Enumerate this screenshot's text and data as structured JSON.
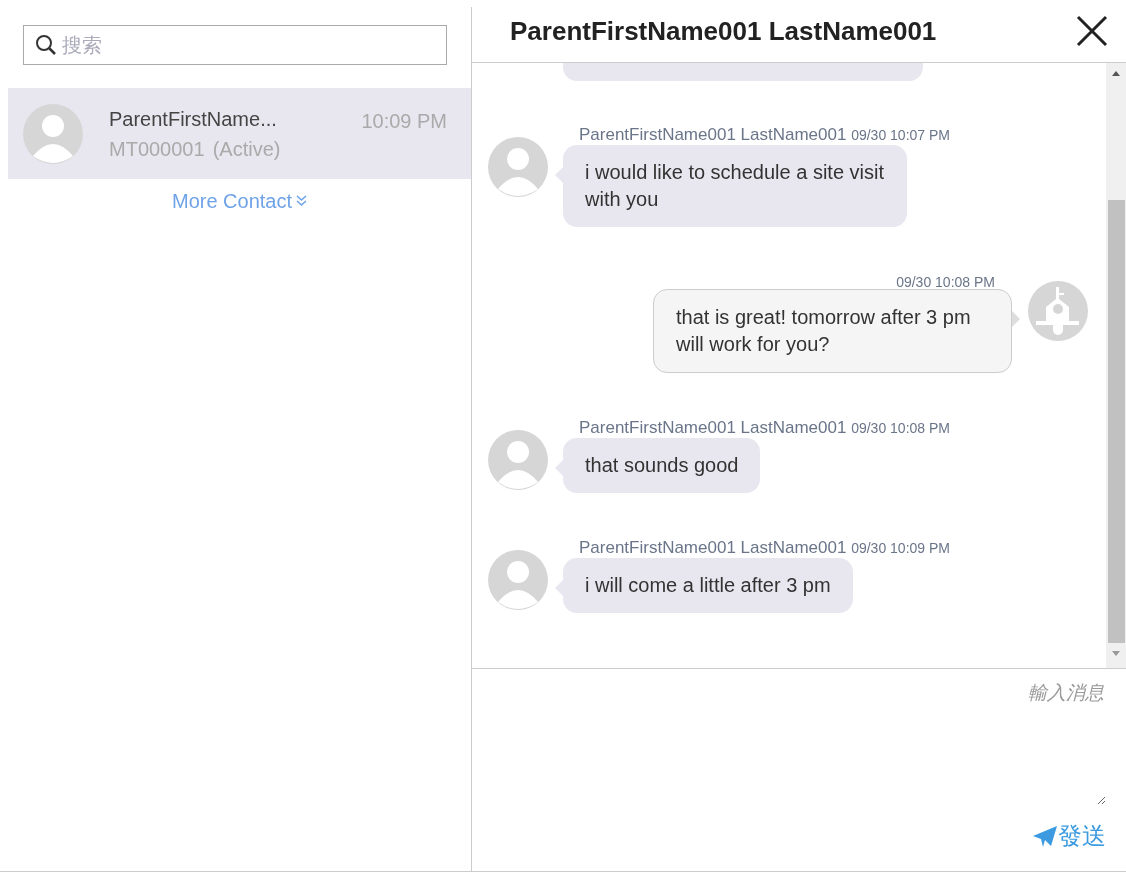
{
  "search": {
    "placeholder": "搜索"
  },
  "contacts": [
    {
      "name": "ParentFirstName...",
      "code": "MT000001",
      "status": "(Active)",
      "time": "10:09 PM",
      "selected": true
    }
  ],
  "more_contacts": {
    "label": "More Contact"
  },
  "chat": {
    "title": "ParentFirstName001 LastName001",
    "messages": [
      {
        "kind": "incoming",
        "sender": "ParentFirstName001 LastName001",
        "time": "09/30 10:07 PM",
        "text": "i would like to schedule a site visit with you"
      },
      {
        "kind": "outgoing",
        "time": "09/30 10:08 PM",
        "text": "that is great! tomorrow after 3 pm will work for you?"
      },
      {
        "kind": "incoming",
        "sender": "ParentFirstName001 LastName001",
        "time": "09/30 10:08 PM",
        "text": "that sounds good"
      },
      {
        "kind": "incoming",
        "sender": "ParentFirstName001 LastName001",
        "time": "09/30 10:09 PM",
        "text": "i will come a little after 3 pm"
      }
    ],
    "input": {
      "placeholder": "輸入消息"
    },
    "send": {
      "label": "發送"
    }
  }
}
